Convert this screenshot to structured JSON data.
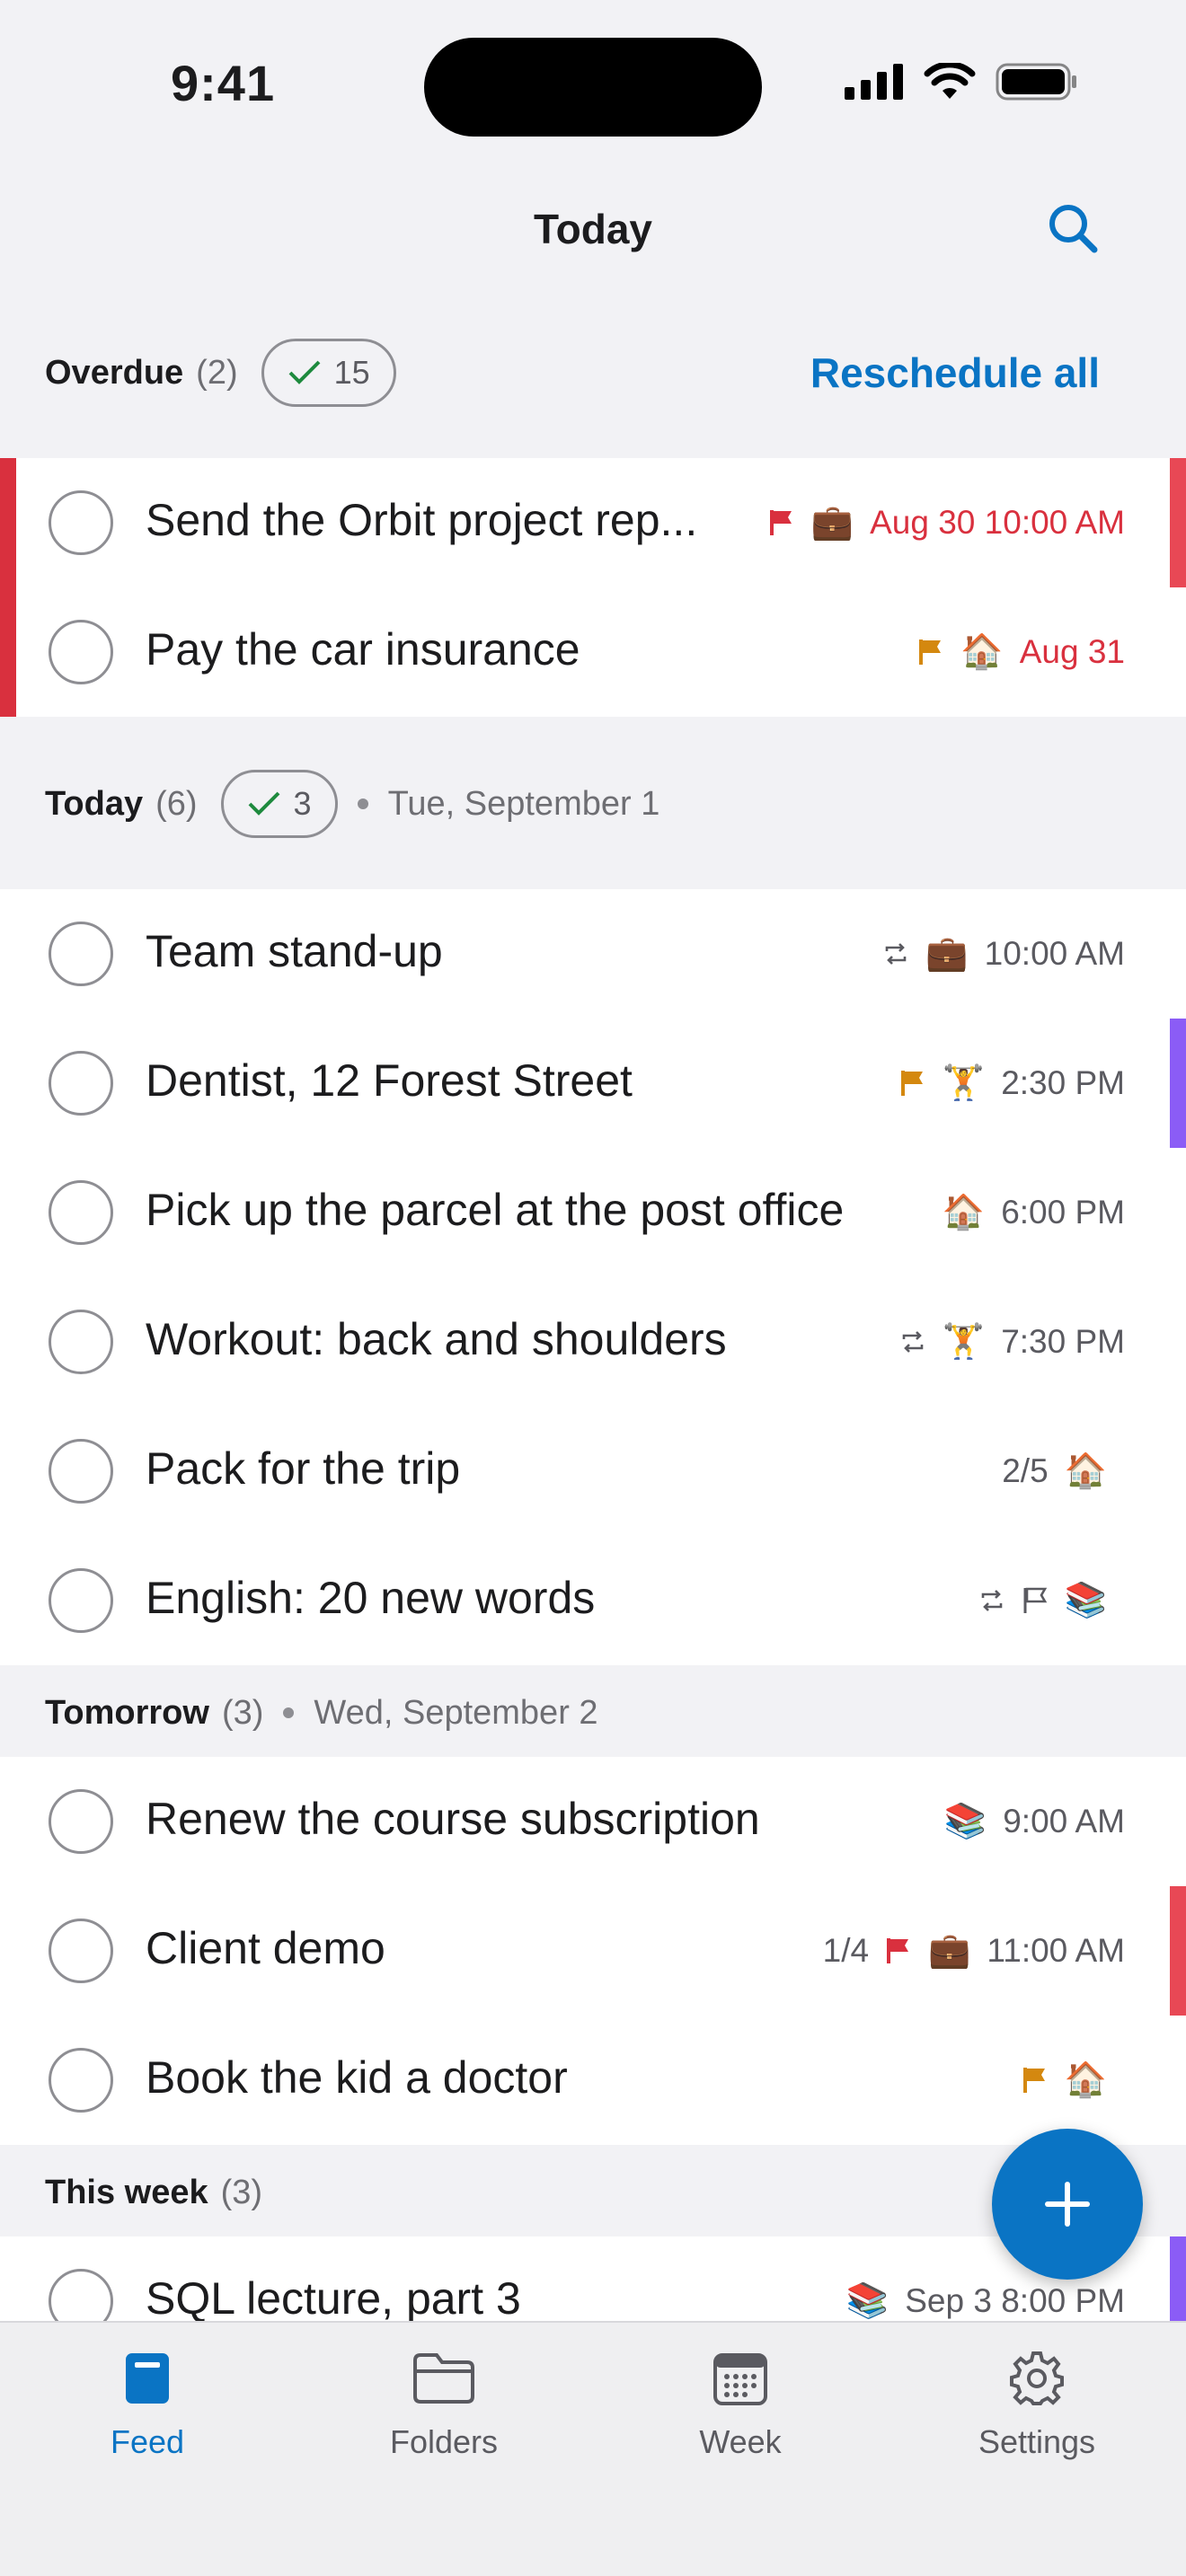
{
  "status_bar": {
    "time": "9:41"
  },
  "header": {
    "title": "Today"
  },
  "colors": {
    "accent": "#0a74c4",
    "overdue": "#d9303e",
    "orange": "#d4880f",
    "purple": "#8b5cf6"
  },
  "overdue": {
    "title": "Overdue",
    "count": "(2)",
    "done_count": "15",
    "reschedule_label": "Reschedule all",
    "tasks": [
      {
        "title": "Send the Orbit project rep...",
        "due": "Aug 30 10:00 AM",
        "icons": [
          "red-flag",
          "briefcase"
        ]
      },
      {
        "title": "Pay the car insurance",
        "due": "Aug 31",
        "icons": [
          "orange-flag",
          "house"
        ]
      }
    ]
  },
  "today": {
    "title": "Today",
    "count": "(6)",
    "done_count": "3",
    "date": "Tue, September 1",
    "tasks": [
      {
        "title": "Team stand-up",
        "due": "10:00 AM",
        "icons": [
          "repeat",
          "briefcase"
        ]
      },
      {
        "title": "Dentist, 12 Forest Street",
        "due": "2:30 PM",
        "icons": [
          "orange-flag",
          "weightlifter"
        ]
      },
      {
        "title": "Pick up the parcel at the post office",
        "due": "6:00 PM",
        "icons": [
          "house"
        ]
      },
      {
        "title": "Workout: back and shoulders",
        "due": "7:30 PM",
        "icons": [
          "repeat",
          "weightlifter"
        ]
      },
      {
        "title": "Pack for the trip",
        "subtasks": "2/5",
        "icons": [
          "house"
        ]
      },
      {
        "title": "English: 20 new words",
        "icons": [
          "repeat",
          "outline-flag",
          "books"
        ]
      }
    ]
  },
  "tomorrow": {
    "title": "Tomorrow",
    "count": "(3)",
    "date": "Wed, September 2",
    "tasks": [
      {
        "title": "Renew the course subscription",
        "due": "9:00 AM",
        "icons": [
          "books"
        ]
      },
      {
        "title": "Client demo",
        "subtasks": "1/4",
        "due": "11:00 AM",
        "icons": [
          "red-flag",
          "briefcase"
        ]
      },
      {
        "title": "Book the kid a doctor",
        "icons": [
          "orange-flag",
          "house"
        ]
      }
    ]
  },
  "this_week": {
    "title": "This week",
    "count": "(3)",
    "tasks": [
      {
        "title": "SQL lecture, part 3",
        "due": "Sep 3 8:00 PM",
        "icons": [
          "books"
        ]
      }
    ]
  },
  "tabs": [
    {
      "label": "Feed",
      "icon": "feed-icon",
      "active": true
    },
    {
      "label": "Folders",
      "icon": "folder-icon"
    },
    {
      "label": "Week",
      "icon": "calendar-icon"
    },
    {
      "label": "Settings",
      "icon": "gear-icon"
    }
  ],
  "glyphs": {
    "briefcase": "💼",
    "house": "🏠",
    "weightlifter": "🏋",
    "books": "📚",
    "plus": "+"
  }
}
